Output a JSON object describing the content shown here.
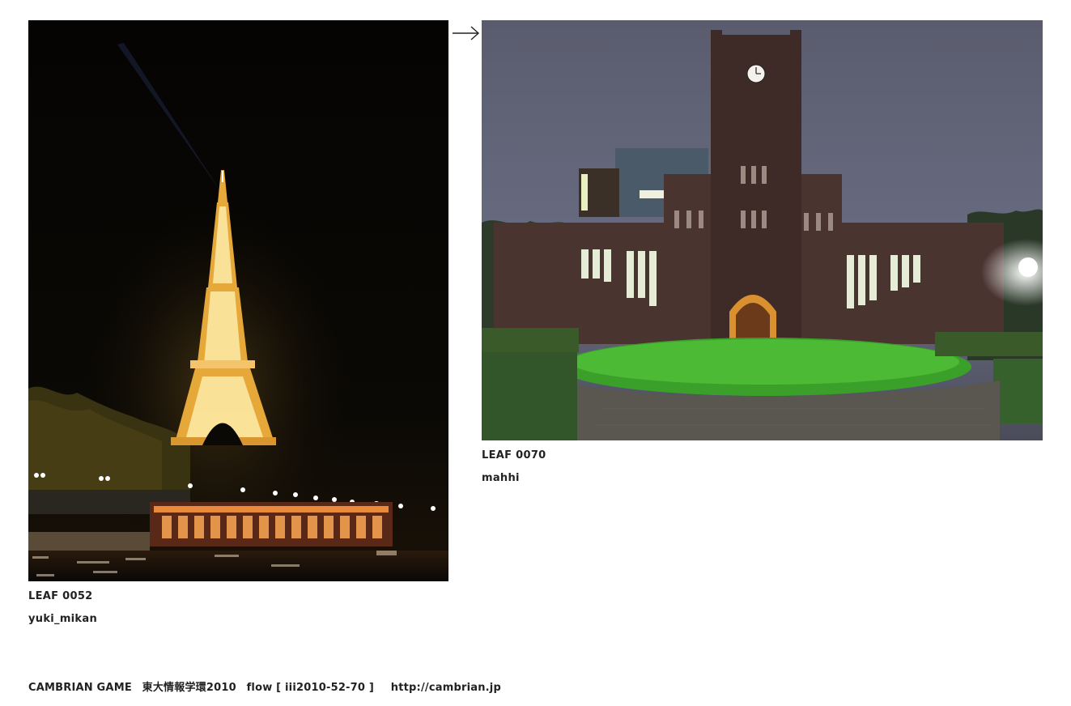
{
  "leaves": [
    {
      "id_label": "LEAF 0052",
      "author": "yuki_mikan",
      "image_subject": "Eiffel Tower illuminated at night beside the Seine"
    },
    {
      "id_label": "LEAF 0070",
      "author": "mahhi",
      "image_subject": "Yasuda Auditorium clock tower at dusk with lawn"
    }
  ],
  "connector_icon": "right-arrow-icon",
  "footer": {
    "brand": "CAMBRIAN GAME",
    "event": "東大情報学環2010",
    "flow": "flow [ iii2010-52-70 ]",
    "url": "http://cambrian.jp"
  }
}
